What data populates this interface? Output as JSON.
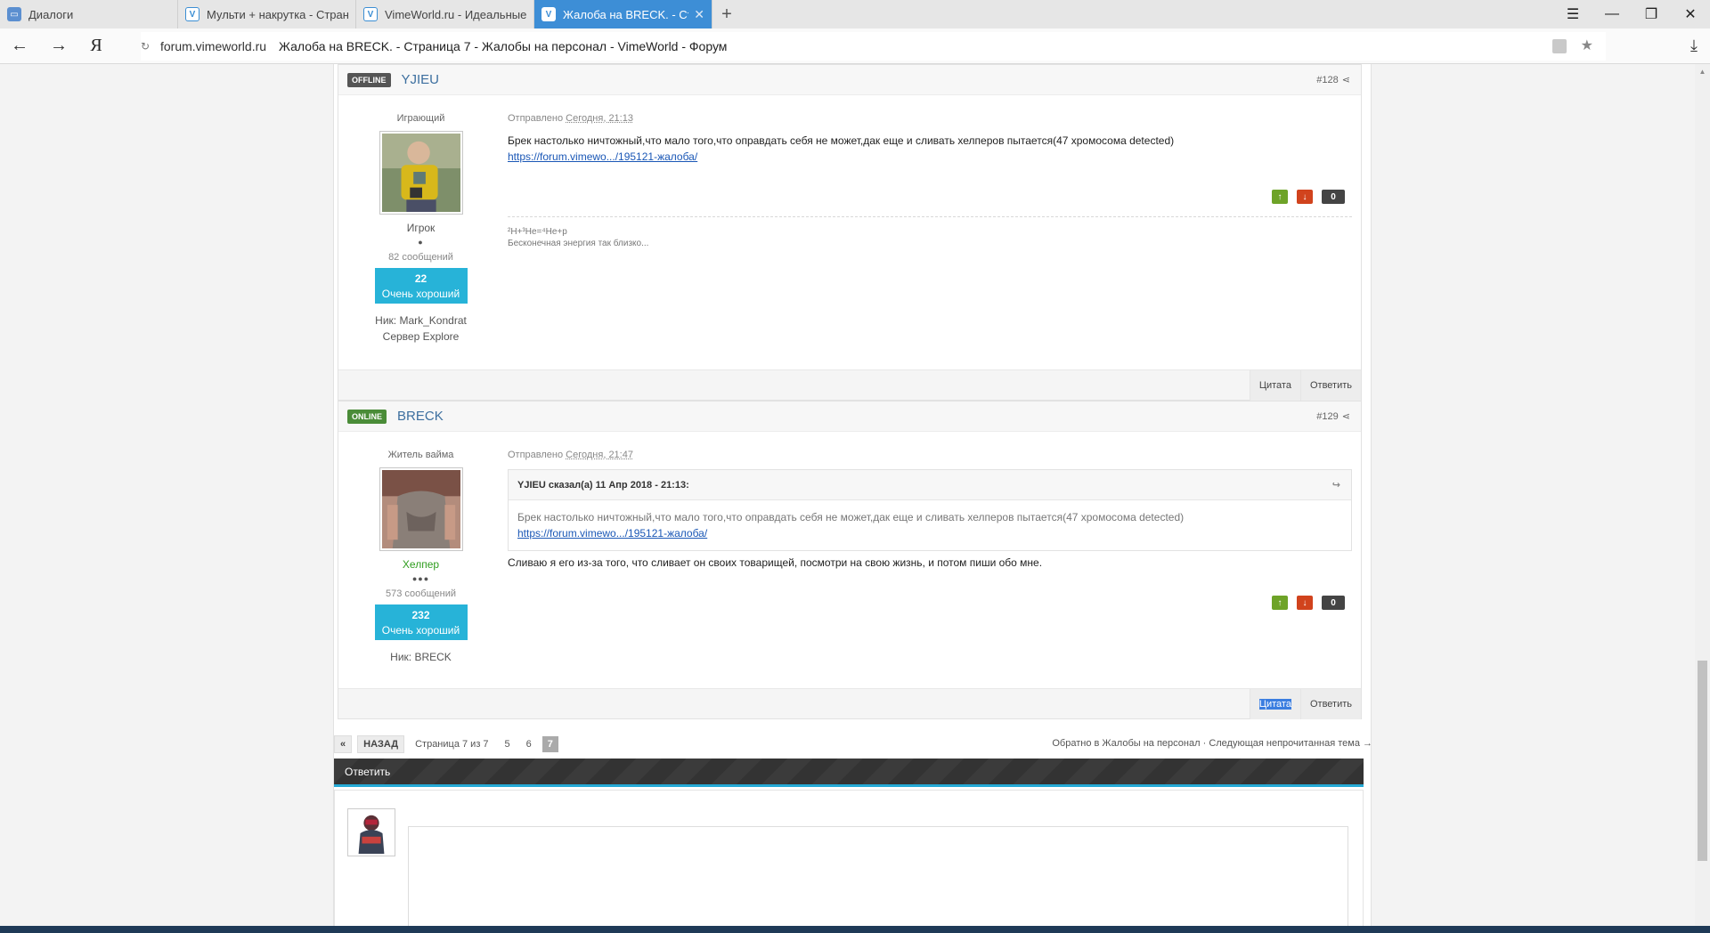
{
  "browser": {
    "tabs": [
      {
        "title": "Диалоги",
        "icon": "dialog-icon"
      },
      {
        "title": "Мульти + накрутка - Стран",
        "icon": "vimeworld-icon"
      },
      {
        "title": "VimeWorld.ru - Идеальные",
        "icon": "vimeworld-icon"
      },
      {
        "title": "Жалоба на BRECK. - Стра",
        "icon": "vimeworld-icon",
        "active": true
      }
    ],
    "address": {
      "domain": "forum.vimeworld.ru",
      "page_title": "Жалоба на BRECK. - Страница 7 - Жалобы на персонал - VimeWorld - Форум"
    }
  },
  "posts": [
    {
      "status": "OFFLINE",
      "author": "YJIEU",
      "number": "#128",
      "group": "Играющий",
      "rank": "Игрок",
      "pips": "●",
      "messages": "82 сообщений",
      "rep_value": "22",
      "rep_label": "Очень хороший",
      "nick_label": "Ник:",
      "nick": "Mark_Kondrat",
      "server_label": "Сервер",
      "server": "Explore",
      "posted_label": "Отправлено",
      "posted_time": "Сегодня, 21:13",
      "text": "Брек настолько ничтожный,что мало того,что оправдать себя не может,дак еще и сливать хелперов пытается(47 хромосома detected)",
      "link": "https://forum.vimewo.../195121-жалоба/",
      "votes": "0",
      "signature_line1": "²H+³He=⁴He+p",
      "signature_line2": "Бесконечная энергия так близко...",
      "quote_btn": "Цитата",
      "reply_btn": "Ответить"
    },
    {
      "status": "ONLINE",
      "author": "BRECK",
      "number": "#129",
      "group": "Житель вайма",
      "rank": "Хелпер",
      "pips": "●●●",
      "messages": "573 сообщений",
      "rep_value": "232",
      "rep_label": "Очень хороший",
      "nick_label": "Ник:",
      "nick": "BRECK",
      "posted_label": "Отправлено",
      "posted_time": "Сегодня, 21:47",
      "quote_head": "YJIEU сказал(а) 11 Апр 2018 - 21:13:",
      "quote_text": "Брек настолько ничтожный,что мало того,что оправдать себя не может,дак еще и сливать хелперов пытается(47 хромосома detected)",
      "quote_link": "https://forum.vimewo.../195121-жалоба/",
      "text": "Сливаю я его из-за того, что сливает он своих товарищей, посмотри на свою жизнь, и потом пиши обо мне.",
      "votes": "0",
      "quote_btn": "Цитата",
      "reply_btn": "Ответить"
    }
  ],
  "pagination": {
    "prev_symbol": "«",
    "back_label": "НАЗАД",
    "page_info": "Страница 7 из 7",
    "pages": [
      "5",
      "6",
      "7"
    ],
    "current": "7",
    "back_to": "Обратно в Жалобы на персонал",
    "separator": "·",
    "next_unread": "Следующая непрочитанная тема →"
  },
  "reply": {
    "title": "Ответить"
  },
  "colors": {
    "accent": "#27b3d8",
    "online": "#4a8c38",
    "offline": "#555555",
    "active_tab": "#3d8ed6"
  }
}
